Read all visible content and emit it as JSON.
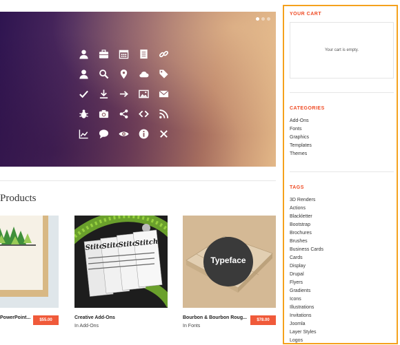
{
  "hero": {
    "dots": 3,
    "icons": [
      "user-icon",
      "briefcase-icon",
      "calendar-icon",
      "document-icon",
      "link-icon",
      "user-alt-icon",
      "search-icon",
      "map-marker-icon",
      "cloud-icon",
      "tag-icon",
      "check-icon",
      "download-icon",
      "arrow-right-icon",
      "image-icon",
      "envelope-icon",
      "bug-icon",
      "camera-icon",
      "share-icon",
      "code-icon",
      "rss-icon",
      "chart-icon",
      "comment-icon",
      "eye-icon",
      "info-icon",
      "close-icon"
    ]
  },
  "main": {
    "section_title": "Products"
  },
  "products": [
    {
      "name": "PowerPoint...",
      "category": "",
      "price": "$55.00"
    },
    {
      "name": "Creative Add-Ons",
      "category_prefix": "In",
      "category": "Add-Ons",
      "price": ""
    },
    {
      "name": "Bourbon & Bourbon Roug...",
      "category_prefix": "In",
      "category": "Fonts",
      "price": "$78.00",
      "thumb_text": "Typeface"
    }
  ],
  "sidebar": {
    "cart": {
      "title": "YOUR CART",
      "empty_text": "Your cart is empty."
    },
    "categories": {
      "title": "CATEGORIES",
      "items": [
        "Add-Ons",
        "Fonts",
        "Graphics",
        "Templates",
        "Themes"
      ]
    },
    "tags": {
      "title": "TAGS",
      "items": [
        "3D Renders",
        "Actions",
        "Blackletter",
        "Bootstrap",
        "Brochures",
        "Brushes",
        "Business Cards",
        "Cards",
        "Display",
        "Drupal",
        "Flyers",
        "Gradients",
        "Icons",
        "Illustrations",
        "Invitations",
        "Joomla",
        "Layer Styles",
        "Logos"
      ]
    }
  },
  "colors": {
    "accent": "#ef4a23",
    "price_badge": "#f05a3a",
    "sidebar_border": "#f5a11c"
  }
}
